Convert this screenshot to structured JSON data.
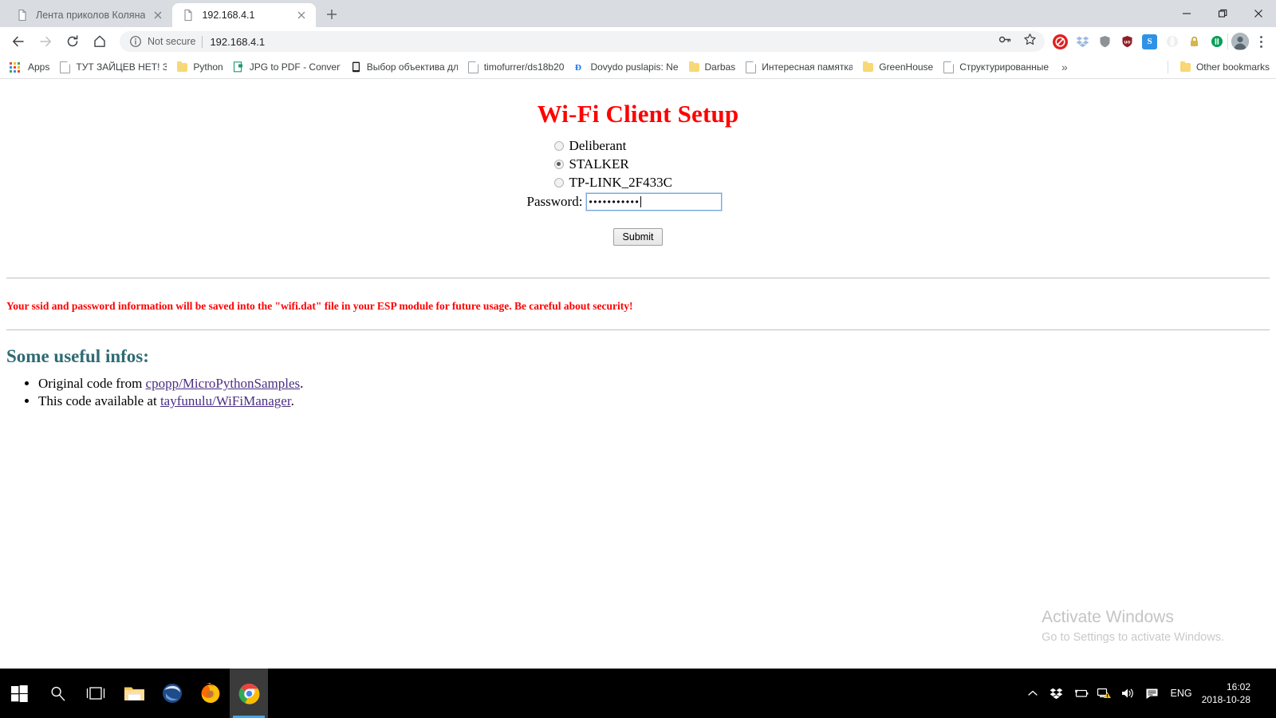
{
  "browser": {
    "tabs": [
      {
        "title": "Лента приколов Коляна",
        "icon": "page-icon",
        "active": false
      },
      {
        "title": "192.168.4.1",
        "icon": "page-icon",
        "active": true
      }
    ],
    "new_tab_label": "+",
    "window_controls": {
      "minimize": "—",
      "maximize": "❐",
      "close": "✕"
    },
    "nav": {
      "back": "back-arrow-icon",
      "forward": "forward-arrow-icon",
      "reload": "reload-icon",
      "home": "home-icon"
    },
    "omnibox": {
      "security_icon": "info-circle-icon",
      "security_text": "Not secure",
      "url": "192.168.4.1"
    },
    "omnibox_actions": {
      "password_key": "key-icon",
      "bookmark_star": "star-icon"
    },
    "extensions": [
      {
        "name": "adblock-extension",
        "glyph": "⛔",
        "color": "#ea2b2b"
      },
      {
        "name": "dropbox-extension",
        "glyph": "❖",
        "color": "#7fa8d8"
      },
      {
        "name": "shield-extension",
        "glyph": "◆",
        "color": "#9aa0a6"
      },
      {
        "name": "ublock-extension",
        "glyph": "uo",
        "color": "#8b1a1a"
      },
      {
        "name": "evernote-skitch-extension",
        "glyph": "S",
        "color": "#2a8fe0"
      },
      {
        "name": "opera-extension",
        "glyph": "●",
        "color": "#e0e0e0"
      },
      {
        "name": "lastpass-extension",
        "glyph": "ὑ2",
        "color": "#c8a33c"
      },
      {
        "name": "pocket-extension",
        "glyph": "ID",
        "color": "#0a9e57"
      }
    ],
    "profile_avatar": "avatar-icon",
    "menu": "three-dot-menu-icon",
    "bookmarks": {
      "apps_label": "Apps",
      "items": [
        {
          "label": "ТУТ ЗАЙЦЕВ НЕТ! Зд",
          "icon": "page-icon"
        },
        {
          "label": "Python",
          "icon": "folder-icon"
        },
        {
          "label": "JPG to PDF - Convert",
          "icon": "page-icon"
        },
        {
          "label": "Выбор объектива дл",
          "icon": "page-icon"
        },
        {
          "label": "timofurrer/ds18b20 ",
          "icon": "page-icon"
        },
        {
          "label": "Dovydo puslapis: Ne",
          "icon": "page-icon"
        },
        {
          "label": "Darbas",
          "icon": "folder-icon"
        },
        {
          "label": "Интересная памятка",
          "icon": "page-icon"
        },
        {
          "label": "GreenHouse",
          "icon": "folder-icon"
        },
        {
          "label": "Структурированные",
          "icon": "page-icon"
        }
      ],
      "overflow": "»",
      "other_bookmarks": {
        "label": "Other bookmarks",
        "icon": "folder-icon"
      }
    }
  },
  "page": {
    "title": "Wi-Fi Client Setup",
    "networks": [
      {
        "ssid": "Deliberant",
        "selected": false
      },
      {
        "ssid": "STALKER",
        "selected": true
      },
      {
        "ssid": "TP-LINK_2F433C",
        "selected": false
      }
    ],
    "password": {
      "label": "Password:",
      "value": "•••••••••••",
      "masked_length": 11
    },
    "submit_label": "Submit",
    "warning": "Your ssid and password information will be saved into the \"wifi.dat\" file in your ESP module for future usage. Be careful about security!",
    "infos_heading": "Some useful infos:",
    "infos": [
      {
        "prefix": "Original code from ",
        "link": "cpopp/MicroPythonSamples",
        "suffix": "."
      },
      {
        "prefix": "This code available at ",
        "link": "tayfunulu/WiFiManager",
        "suffix": "."
      }
    ],
    "colors": {
      "title": "#ff0000",
      "warning": "#ff0000",
      "heading": "#2f6b75",
      "link": "#1a0dab"
    }
  },
  "watermark": {
    "line1": "Activate Windows",
    "line2": "Go to Settings to activate Windows."
  },
  "taskbar": {
    "items": [
      {
        "name": "start-button",
        "icon": "windows-logo-icon",
        "active": false
      },
      {
        "name": "search-button",
        "icon": "search-icon",
        "active": false
      },
      {
        "name": "task-view-button",
        "icon": "task-view-icon",
        "active": false
      },
      {
        "name": "file-explorer",
        "icon": "folder-icon",
        "active": false
      },
      {
        "name": "thunderbird",
        "icon": "thunderbird-icon",
        "active": false
      },
      {
        "name": "firefox",
        "icon": "firefox-icon",
        "active": false
      },
      {
        "name": "chrome",
        "icon": "chrome-icon",
        "active": true
      }
    ],
    "tray": {
      "overflow": "show-hidden-icons",
      "icons": [
        "dropbox-tray-icon",
        "battery-icon",
        "network-warning-icon",
        "volume-icon",
        "action-center-icon"
      ],
      "language": "ENG",
      "time": "16:02",
      "date": "2018-10-28"
    }
  }
}
